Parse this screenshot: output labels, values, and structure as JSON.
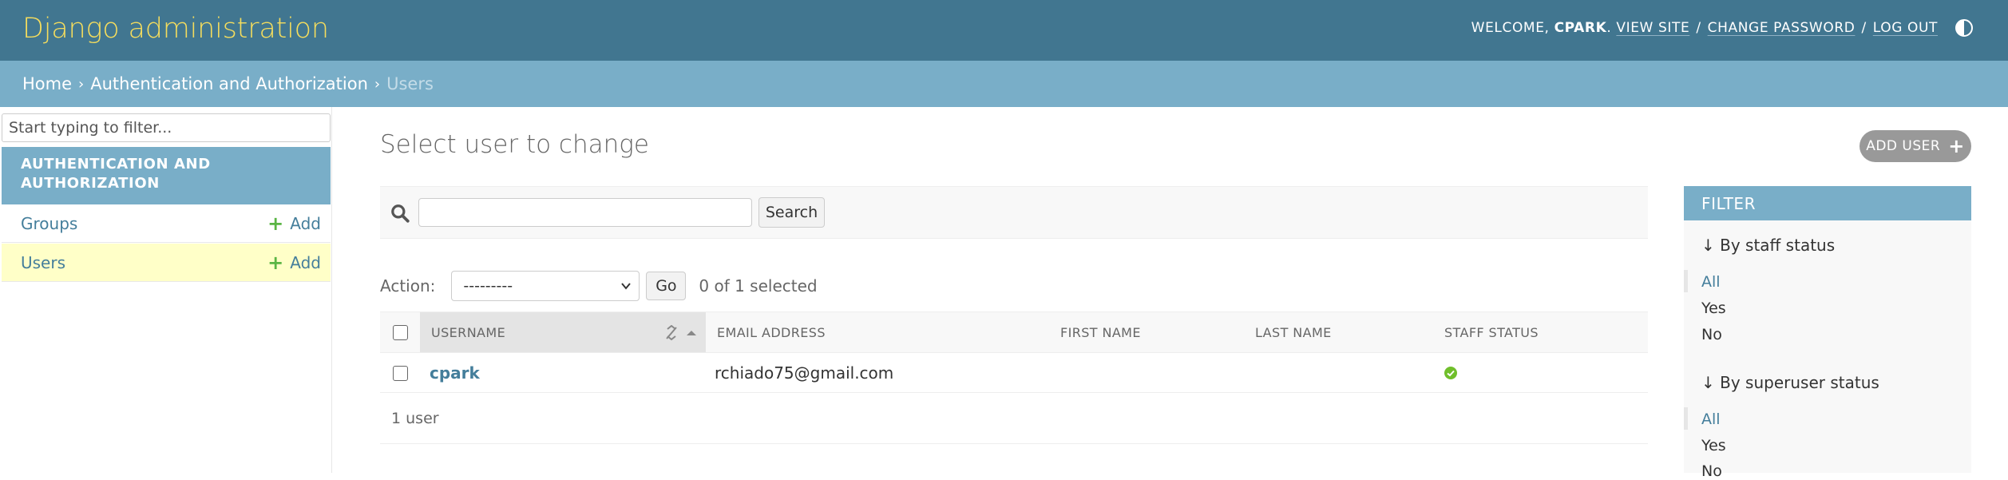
{
  "header": {
    "site_title": "Django administration",
    "welcome": "WELCOME,",
    "username": "CPARK",
    "view_site": "VIEW SITE",
    "change_password": "CHANGE PASSWORD",
    "log_out": "LOG OUT",
    "separator": "/"
  },
  "breadcrumbs": {
    "home": "Home",
    "app": "Authentication and Authorization",
    "current": "Users",
    "separator": "›"
  },
  "sidebar": {
    "filter_placeholder": "Start typing to filter...",
    "app_name": "AUTHENTICATION AND AUTHORIZATION",
    "models": [
      {
        "label": "Groups",
        "add": "Add"
      },
      {
        "label": "Users",
        "add": "Add"
      }
    ]
  },
  "main": {
    "title": "Select user to change",
    "add_button": "ADD USER",
    "search_button": "Search",
    "search_value": "",
    "action_label": "Action:",
    "action_selected": "---------",
    "go_button": "Go",
    "action_counter": "0 of 1 selected",
    "columns": [
      "USERNAME",
      "EMAIL ADDRESS",
      "FIRST NAME",
      "LAST NAME",
      "STAFF STATUS"
    ],
    "rows": [
      {
        "username": "cpark",
        "email": "rchiado75@gmail.com",
        "first_name": "",
        "last_name": "",
        "staff_status": true
      }
    ],
    "paginator": "1 user"
  },
  "filter": {
    "title": "FILTER",
    "groups": [
      {
        "title": "↓ By staff status",
        "options": [
          "All",
          "Yes",
          "No"
        ],
        "selected": "All"
      },
      {
        "title": "↓ By superuser status",
        "options": [
          "All",
          "Yes",
          "No"
        ],
        "selected": "All"
      }
    ]
  },
  "colors": {
    "header_bg": "#417690",
    "breadcrumb_bg": "#79aec8",
    "title_yellow": "#f5dd5d",
    "link": "#447e9b",
    "add_green": "#5ab544",
    "selected_row": "#ffffc8"
  },
  "icons": {
    "search": "search-icon",
    "theme": "theme-toggle-icon",
    "plus": "plus-icon",
    "check": "check-circle-icon"
  }
}
